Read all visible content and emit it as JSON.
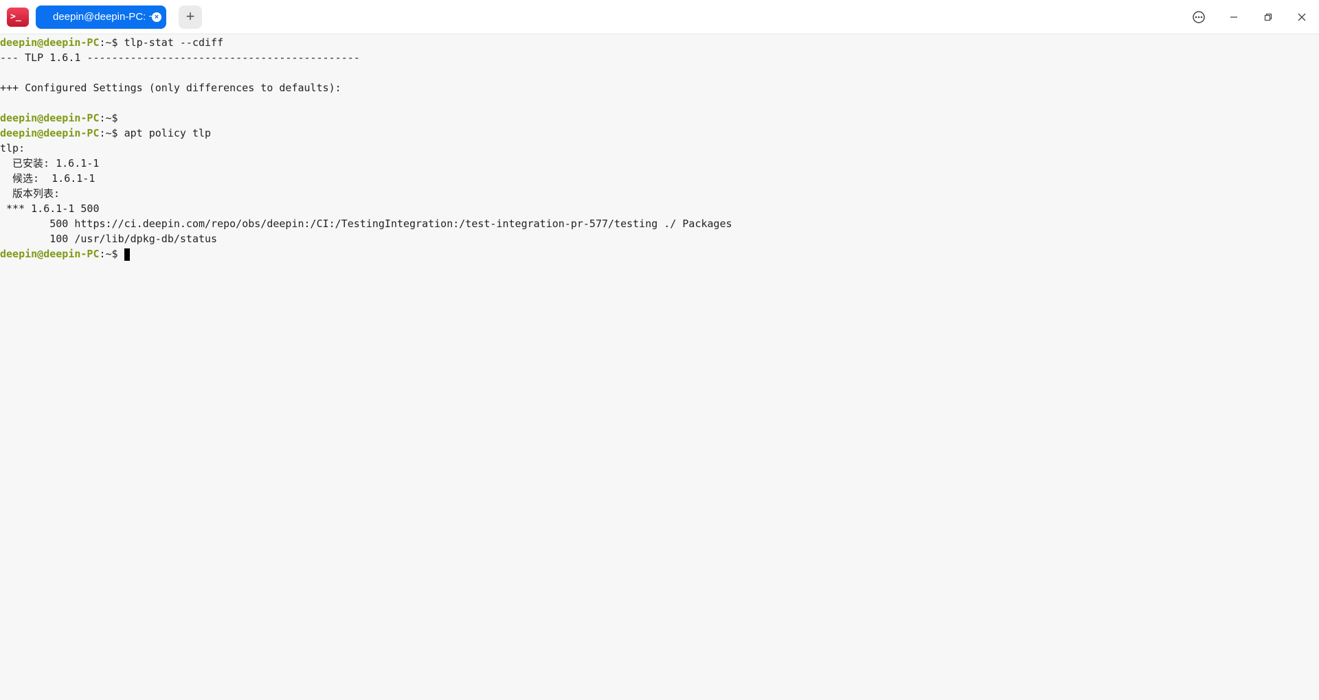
{
  "app": {
    "icon_text": ">_",
    "tab_title": "deepin@deepin-PC: ~",
    "new_tab_glyph": "+",
    "menu_glyph": "⋯",
    "minimize_glyph": "—",
    "maximize_glyph": "❐",
    "close_glyph": "✕"
  },
  "terminal": {
    "prompt_user": "deepin@deepin-PC",
    "prompt_suffix": ":~$",
    "lines": {
      "l1_cmd": " tlp-stat --cdiff",
      "l2": "--- TLP 1.6.1 --------------------------------------------",
      "l3": "",
      "l4": "+++ Configured Settings (only differences to defaults):",
      "l5": "",
      "l6_cmd": "",
      "l7_cmd": " apt policy tlp",
      "l8": "tlp:",
      "l9": "  已安装: 1.6.1-1",
      "l10": "  候选:  1.6.1-1",
      "l11": "  版本列表:",
      "l12": " *** 1.6.1-1 500",
      "l13": "        500 https://ci.deepin.com/repo/obs/deepin:/CI:/TestingIntegration:/test-integration-pr-577/testing ./ Packages",
      "l14": "        100 /usr/lib/dpkg-db/status",
      "l15_cmd": " "
    }
  },
  "colors": {
    "tab_active": "#0a72f0",
    "prompt_user": "#7f9a17",
    "background": "#f7f7f7"
  }
}
